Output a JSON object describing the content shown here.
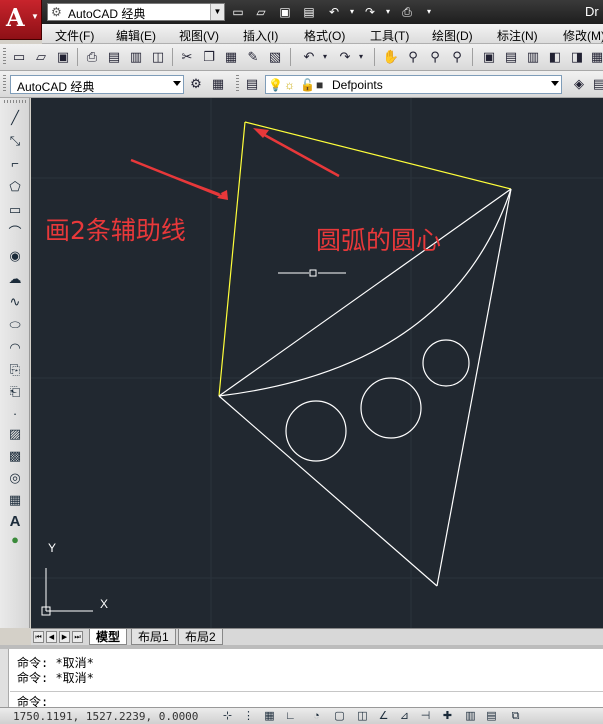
{
  "title": {
    "logo_glyph": "A",
    "workspace": "AutoCAD 经典",
    "app_title_fragment": "Dr"
  },
  "menu": {
    "items": [
      "文件(F)",
      "编辑(E)",
      "视图(V)",
      "插入(I)",
      "格式(O)",
      "工具(T)",
      "绘图(D)",
      "标注(N)",
      "修改(M)"
    ]
  },
  "toolbar": {
    "workspace_combo": "AutoCAD 经典",
    "layer_combo": "Defpoints"
  },
  "layout_tabs": {
    "items": [
      "模型",
      "布局1",
      "布局2"
    ],
    "active": "模型"
  },
  "command": {
    "history": [
      "命令: *取消*",
      "命令: *取消*"
    ],
    "prompt": "命令:"
  },
  "status": {
    "coordinates": "1750.1191, 1527.2239, 0.0000"
  },
  "annotations": {
    "left_label": "画2条辅助线",
    "right_label": "圆弧的圆心"
  },
  "ucs": {
    "y_label": "Y",
    "x_label": "X"
  },
  "colors": {
    "canvas_bg": "#212830",
    "drawing_lines": "#ffffff",
    "aux_lines": "#ffff3a",
    "annotation": "#e8383a",
    "logo_red": "#c8242c"
  }
}
